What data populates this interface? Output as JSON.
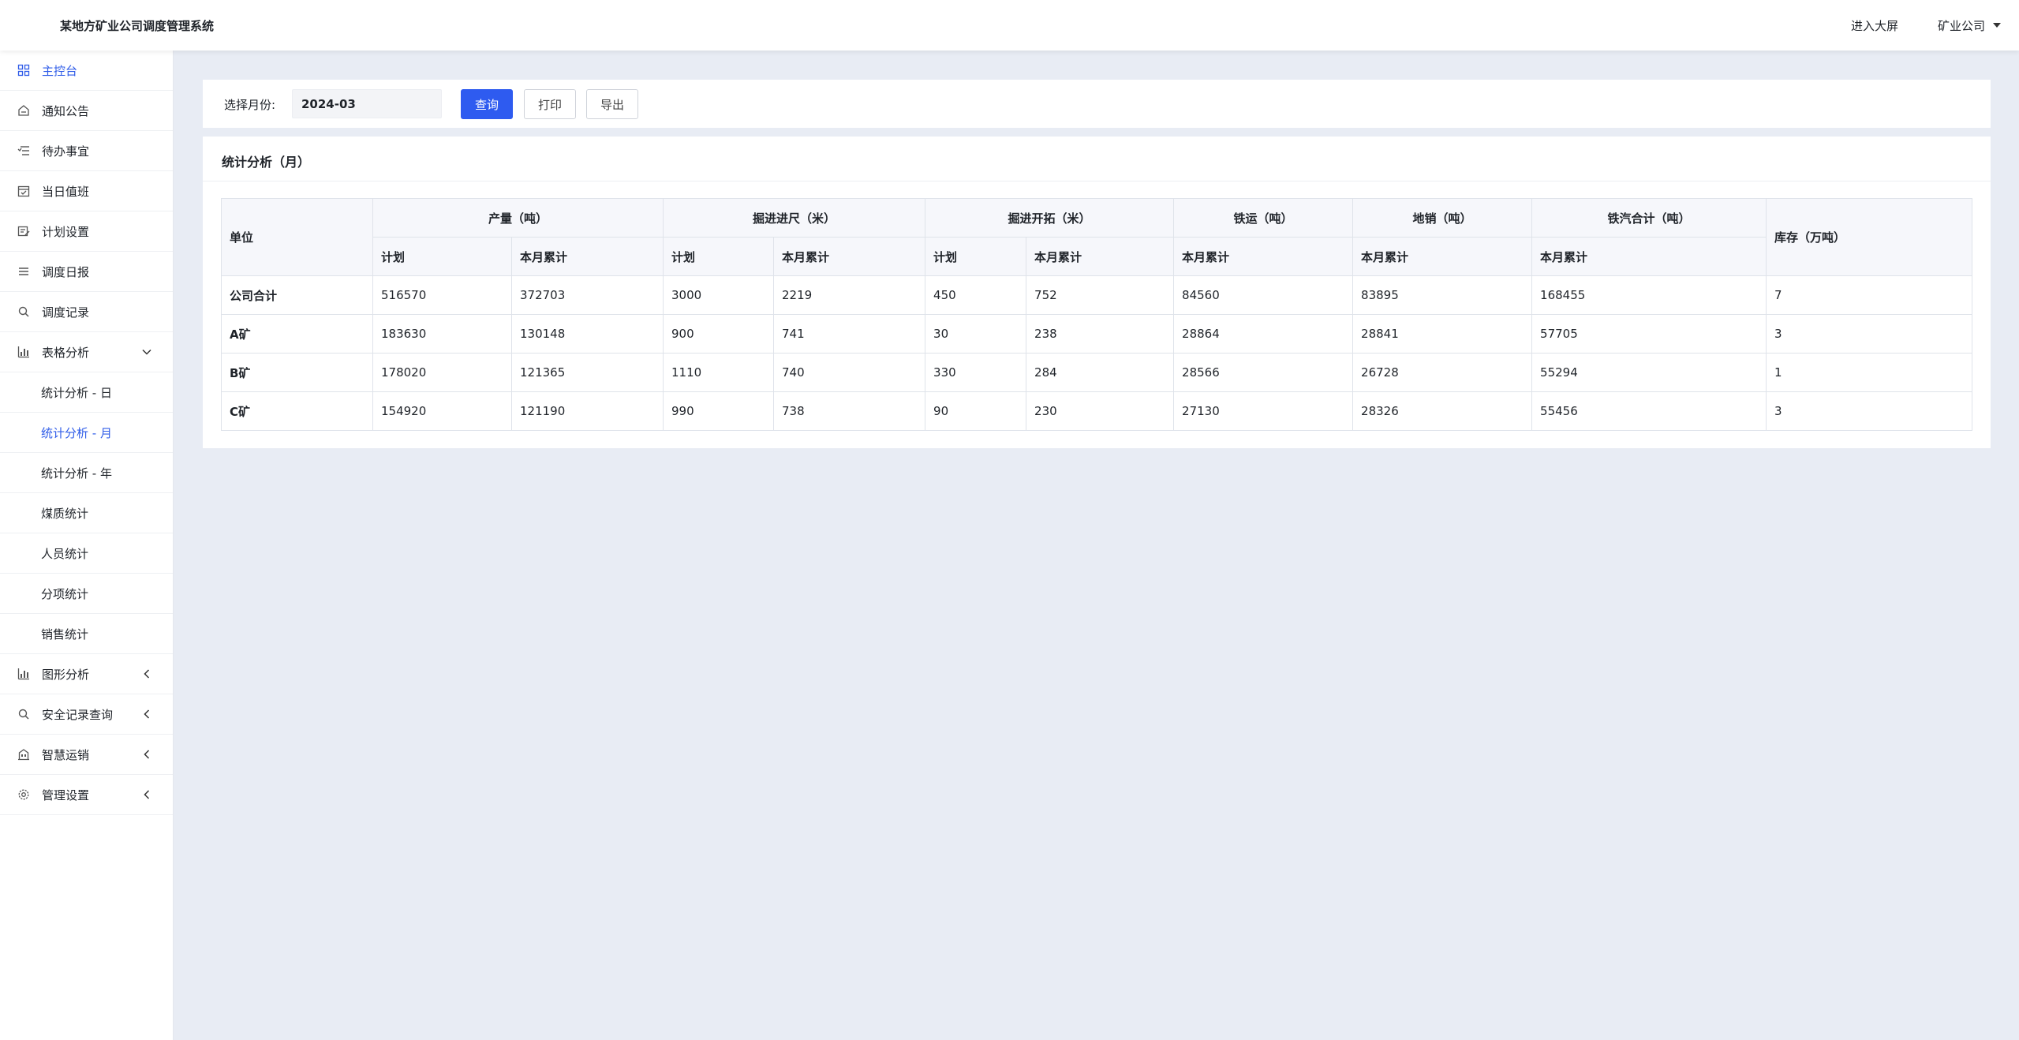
{
  "header": {
    "title": "某地方矿业公司调度管理系统",
    "enter_screen": "进入大屏",
    "company": "矿业公司"
  },
  "sidebar": {
    "items": [
      {
        "label": "主控台",
        "icon": "dashboard-icon"
      },
      {
        "label": "通知公告",
        "icon": "notice-icon"
      },
      {
        "label": "待办事宜",
        "icon": "todo-icon"
      },
      {
        "label": "当日值班",
        "icon": "calendar-icon"
      },
      {
        "label": "计划设置",
        "icon": "plan-icon"
      },
      {
        "label": "调度日报",
        "icon": "list-icon"
      },
      {
        "label": "调度记录",
        "icon": "search-icon"
      },
      {
        "label": "表格分析",
        "icon": "chart-icon"
      }
    ],
    "sub_items": [
      {
        "label": "统计分析 - 日"
      },
      {
        "label": "统计分析 - 月"
      },
      {
        "label": "统计分析 - 年"
      },
      {
        "label": "煤质统计"
      },
      {
        "label": "人员统计"
      },
      {
        "label": "分项统计"
      },
      {
        "label": "销售统计"
      }
    ],
    "bottom_items": [
      {
        "label": "图形分析",
        "icon": "chart-icon"
      },
      {
        "label": "安全记录查询",
        "icon": "search-icon"
      },
      {
        "label": "智慧运销",
        "icon": "building-icon"
      },
      {
        "label": "管理设置",
        "icon": "gear-icon"
      }
    ]
  },
  "filter": {
    "label": "选择月份:",
    "month_value": "2024-03",
    "query_label": "查询",
    "print_label": "打印",
    "export_label": "导出"
  },
  "table": {
    "title": "统计分析（月）",
    "group_headers": {
      "unit": "单位",
      "output": "产量（吨）",
      "advance": "掘进进尺（米）",
      "development": "掘进开拓（米）",
      "rail": "铁运（吨）",
      "local_sales": "地销（吨）",
      "rail_road_total": "铁汽合计（吨）",
      "stock": "库存（万吨）"
    },
    "sub_headers": {
      "plan": "计划",
      "month_cumulative": "本月累计"
    },
    "rows": [
      {
        "unit": "公司合计",
        "output_plan": "516570",
        "output_cum": "372703",
        "advance_plan": "3000",
        "advance_cum": "2219",
        "dev_plan": "450",
        "dev_cum": "752",
        "rail_cum": "84560",
        "local_cum": "83895",
        "total_cum": "168455",
        "stock": "7"
      },
      {
        "unit": "A矿",
        "output_plan": "183630",
        "output_cum": "130148",
        "advance_plan": "900",
        "advance_cum": "741",
        "dev_plan": "30",
        "dev_cum": "238",
        "rail_cum": "28864",
        "local_cum": "28841",
        "total_cum": "57705",
        "stock": "3"
      },
      {
        "unit": "B矿",
        "output_plan": "178020",
        "output_cum": "121365",
        "advance_plan": "1110",
        "advance_cum": "740",
        "dev_plan": "330",
        "dev_cum": "284",
        "rail_cum": "28566",
        "local_cum": "26728",
        "total_cum": "55294",
        "stock": "1"
      },
      {
        "unit": "C矿",
        "output_plan": "154920",
        "output_cum": "121190",
        "advance_plan": "990",
        "advance_cum": "738",
        "dev_plan": "90",
        "dev_cum": "230",
        "rail_cum": "27130",
        "local_cum": "28326",
        "total_cum": "55456",
        "stock": "3"
      }
    ]
  },
  "colors": {
    "accent": "#2e5bf0",
    "active_text": "#2f5ce8",
    "page_bg": "#e8ecf4"
  }
}
